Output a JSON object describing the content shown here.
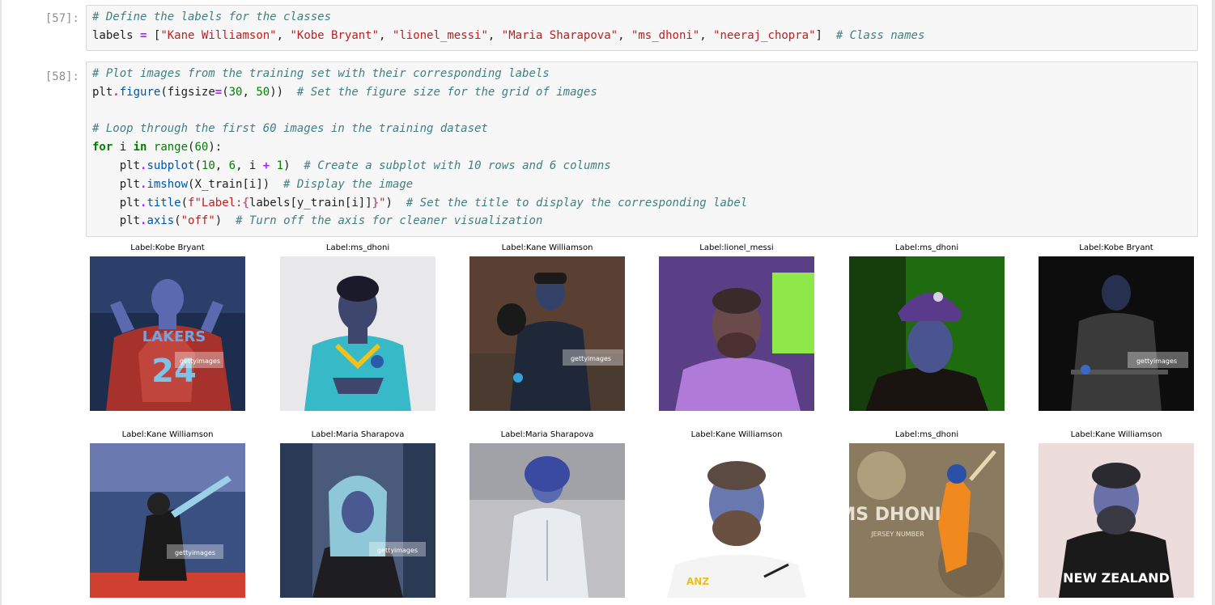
{
  "cells": [
    {
      "prompt": "[57]:",
      "lines": [
        [
          {
            "t": "# Define the labels for the classes",
            "c": "cm"
          }
        ],
        [
          {
            "t": "labels ",
            "c": ""
          },
          {
            "t": "=",
            "c": "op"
          },
          {
            "t": " [",
            "c": ""
          },
          {
            "t": "\"Kane Williamson\"",
            "c": "st"
          },
          {
            "t": ", ",
            "c": ""
          },
          {
            "t": "\"Kobe Bryant\"",
            "c": "st"
          },
          {
            "t": ", ",
            "c": ""
          },
          {
            "t": "\"lionel_messi\"",
            "c": "st"
          },
          {
            "t": ", ",
            "c": ""
          },
          {
            "t": "\"Maria Sharapova\"",
            "c": "st"
          },
          {
            "t": ", ",
            "c": ""
          },
          {
            "t": "\"ms_dhoni\"",
            "c": "st"
          },
          {
            "t": ", ",
            "c": ""
          },
          {
            "t": "\"neeraj_chopra\"",
            "c": "st"
          },
          {
            "t": "]  ",
            "c": ""
          },
          {
            "t": "# Class names",
            "c": "cm"
          }
        ]
      ]
    },
    {
      "prompt": "[58]:",
      "lines": [
        [
          {
            "t": "# Plot images from the training set with their corresponding labels",
            "c": "cm"
          }
        ],
        [
          {
            "t": "plt",
            "c": ""
          },
          {
            "t": ".",
            "c": "op"
          },
          {
            "t": "figure",
            "c": "fn"
          },
          {
            "t": "(figsize",
            "c": ""
          },
          {
            "t": "=",
            "c": "op"
          },
          {
            "t": "(",
            "c": ""
          },
          {
            "t": "30",
            "c": "nu"
          },
          {
            "t": ", ",
            "c": ""
          },
          {
            "t": "50",
            "c": "nu"
          },
          {
            "t": "))  ",
            "c": ""
          },
          {
            "t": "# Set the figure size for the grid of images",
            "c": "cm"
          }
        ],
        [],
        [
          {
            "t": "# Loop through the first 60 images in the training dataset",
            "c": "cm"
          }
        ],
        [
          {
            "t": "for",
            "c": "kw"
          },
          {
            "t": " i ",
            "c": ""
          },
          {
            "t": "in",
            "c": "kw"
          },
          {
            "t": " ",
            "c": ""
          },
          {
            "t": "range",
            "c": "nu"
          },
          {
            "t": "(",
            "c": ""
          },
          {
            "t": "60",
            "c": "nu"
          },
          {
            "t": "):",
            "c": ""
          }
        ],
        [
          {
            "t": "    plt",
            "c": ""
          },
          {
            "t": ".",
            "c": "op"
          },
          {
            "t": "subplot",
            "c": "fn"
          },
          {
            "t": "(",
            "c": ""
          },
          {
            "t": "10",
            "c": "nu"
          },
          {
            "t": ", ",
            "c": ""
          },
          {
            "t": "6",
            "c": "nu"
          },
          {
            "t": ", i ",
            "c": ""
          },
          {
            "t": "+",
            "c": "op"
          },
          {
            "t": " ",
            "c": ""
          },
          {
            "t": "1",
            "c": "nu"
          },
          {
            "t": ")  ",
            "c": ""
          },
          {
            "t": "# Create a subplot with 10 rows and 6 columns",
            "c": "cm"
          }
        ],
        [
          {
            "t": "    plt",
            "c": ""
          },
          {
            "t": ".",
            "c": "op"
          },
          {
            "t": "imshow",
            "c": "fn"
          },
          {
            "t": "(X_train[i])  ",
            "c": ""
          },
          {
            "t": "# Display the image",
            "c": "cm"
          }
        ],
        [
          {
            "t": "    plt",
            "c": ""
          },
          {
            "t": ".",
            "c": "op"
          },
          {
            "t": "title",
            "c": "fn"
          },
          {
            "t": "(",
            "c": ""
          },
          {
            "t": "f\"Label:",
            "c": "st"
          },
          {
            "t": "{",
            "c": "ip"
          },
          {
            "t": "labels[y_train[i]]",
            "c": ""
          },
          {
            "t": "}",
            "c": "ip"
          },
          {
            "t": "\"",
            "c": "st"
          },
          {
            "t": ")  ",
            "c": ""
          },
          {
            "t": "# Set the title to display the corresponding label",
            "c": "cm"
          }
        ],
        [
          {
            "t": "    plt",
            "c": ""
          },
          {
            "t": ".",
            "c": "op"
          },
          {
            "t": "axis",
            "c": "fn"
          },
          {
            "t": "(",
            "c": ""
          },
          {
            "t": "\"off\"",
            "c": "st"
          },
          {
            "t": ")  ",
            "c": ""
          },
          {
            "t": "# Turn off the axis for cleaner visualization",
            "c": "cm"
          }
        ]
      ]
    }
  ],
  "output": {
    "titles": [
      "Label:Kobe Bryant",
      "Label:ms_dhoni",
      "Label:Kane Williamson",
      "Label:lionel_messi",
      "Label:ms_dhoni",
      "Label:Kobe Bryant",
      "Label:Kane Williamson",
      "Label:Maria Sharapova",
      "Label:Maria Sharapova",
      "Label:Kane Williamson",
      "Label:ms_dhoni",
      "Label:Kane Williamson"
    ],
    "image_text": {
      "watermark": "gettyimages",
      "lakers": "LAKERS",
      "jersey_number": "24",
      "dhoni_banner": "MS DHONI",
      "dhoni_sub": "JERSEY NUMBER",
      "anz": "ANZ",
      "new_zealand": "NEW ZEALAND"
    },
    "colors": {
      "bg_dark": "#0d0d0d",
      "bg_green": "#1f6b10",
      "bg_purple": "#5a3f86",
      "jersey_red": "#a6322b",
      "jersey_teal": "#37b9c8",
      "dhoni_orange": "#f08a1e"
    }
  }
}
